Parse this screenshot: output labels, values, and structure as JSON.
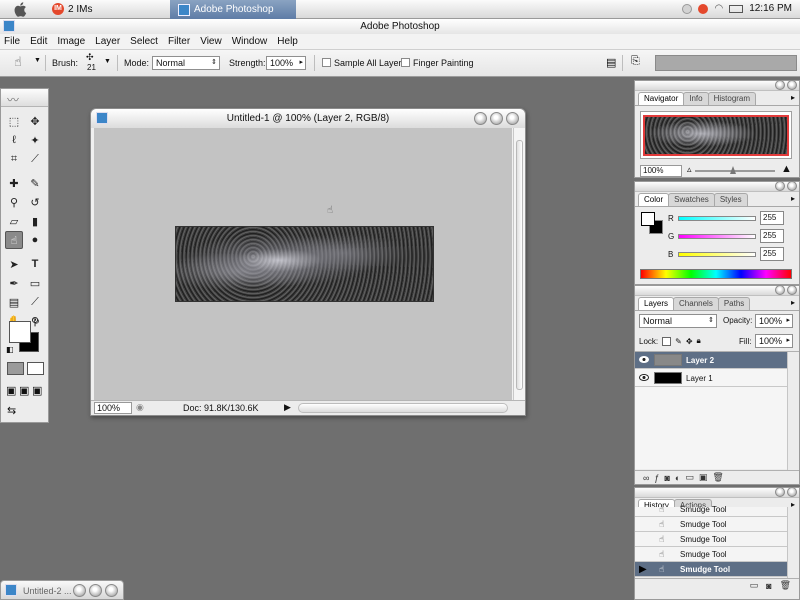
{
  "system_bar": {
    "im_label": "2 IMs",
    "taskbar_item": "Adobe Photoshop",
    "clock": "12:16 PM"
  },
  "app": {
    "title": "Adobe Photoshop"
  },
  "menu": [
    "File",
    "Edit",
    "Image",
    "Layer",
    "Select",
    "Filter",
    "View",
    "Window",
    "Help"
  ],
  "options_bar": {
    "brush_label": "Brush:",
    "brush_size": "21",
    "mode_label": "Mode:",
    "mode_value": "Normal",
    "strength_label": "Strength:",
    "strength_value": "100%",
    "sample_all_layers": "Sample All Layers",
    "finger_painting": "Finger Painting"
  },
  "document": {
    "title": "Untitled-1 @ 100% (Layer 2, RGB/8)",
    "zoom": "100%",
    "doc_info": "Doc: 91.8K/130.6K"
  },
  "minimized_doc": {
    "title": "Untitled-2 ..."
  },
  "navigator": {
    "tabs": [
      "Navigator",
      "Info",
      "Histogram"
    ],
    "zoom": "100%"
  },
  "color": {
    "tabs": [
      "Color",
      "Swatches",
      "Styles"
    ],
    "channels": [
      {
        "label": "R",
        "value": "255",
        "color": "#00e0f0"
      },
      {
        "label": "G",
        "value": "255",
        "color": "#e020e0"
      },
      {
        "label": "B",
        "value": "255",
        "color": "#f0f000"
      }
    ]
  },
  "layers": {
    "tabs": [
      "Layers",
      "Channels",
      "Paths"
    ],
    "blend_mode": "Normal",
    "opacity_label": "Opacity:",
    "opacity": "100%",
    "lock_label": "Lock:",
    "fill_label": "Fill:",
    "fill": "100%",
    "items": [
      {
        "name": "Layer 2",
        "selected": true
      },
      {
        "name": "Layer 1",
        "selected": false
      }
    ]
  },
  "history": {
    "tabs": [
      "History",
      "Actions"
    ],
    "items": [
      "Smudge Tool",
      "Smudge Tool",
      "Smudge Tool",
      "Smudge Tool",
      "Smudge Tool"
    ]
  },
  "colors": {
    "workspace": "#6f6f6f",
    "canvas": "#c3c3c3",
    "selection": "#5e6f86"
  }
}
